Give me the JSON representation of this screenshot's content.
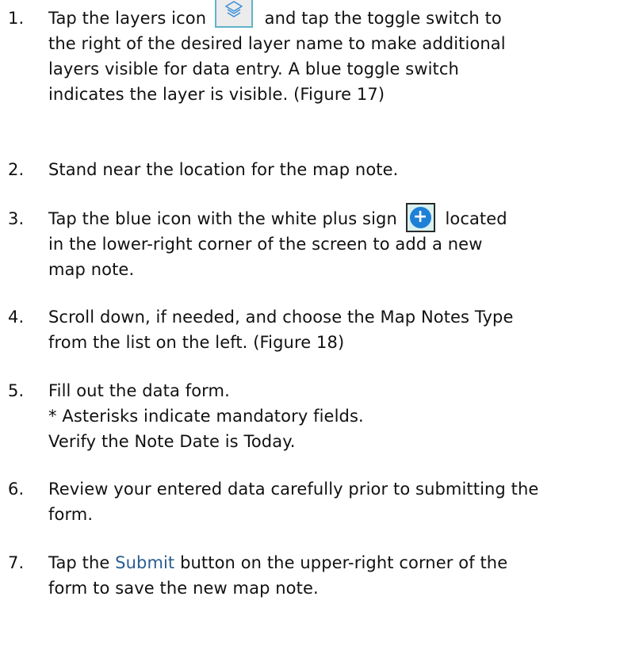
{
  "steps": [
    {
      "number": "1.",
      "lines": [
        {
          "before": "Tap the layers icon",
          "icon": "layers-icon",
          "after": "and tap the toggle switch to"
        },
        "the right of the desired layer name to make additional",
        "layers visible for data entry. A blue toggle switch",
        "indicates the layer is visible. (Figure 17)"
      ]
    },
    {
      "number": "2.",
      "lines": [
        "Stand near the location for the map note."
      ]
    },
    {
      "number": "3.",
      "lines": [
        {
          "before": "Tap the blue icon with the white plus sign",
          "icon": "plus-circle-icon",
          "after": "located"
        },
        "in the lower-right corner of the screen to add a new",
        "map note."
      ]
    },
    {
      "number": "4.",
      "lines": [
        "Scroll down, if needed, and choose the Map Notes Type",
        "from the list on the left. (Figure 18)"
      ]
    },
    {
      "number": "5.",
      "lines": [
        "Fill out the data form.",
        "* Asterisks indicate mandatory fields.",
        "Verify the Note Date is Today."
      ]
    },
    {
      "number": "6.",
      "lines": [
        "Review your entered data carefully prior to submitting the",
        "form."
      ]
    },
    {
      "number": "7.",
      "lines": [
        {
          "before": "Tap the",
          "link": "Submit",
          "after": "button on the upper-right corner of the"
        },
        "form to save the new map note."
      ]
    }
  ],
  "colors": {
    "text": "#111111",
    "link": "#2a5d8f",
    "plus_button": "#1e7fd6",
    "layers_icon": "#3a8fd6"
  },
  "icons": {
    "plus_glyph": "+"
  }
}
